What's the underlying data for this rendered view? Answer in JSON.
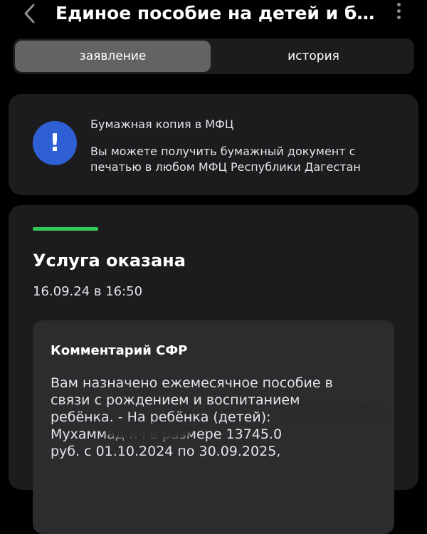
{
  "header": {
    "title": "Единое пособие на детей и бе...",
    "back_icon": "chevron-left-icon",
    "more_icon": "more-vertical-icon"
  },
  "segment": {
    "tabs": [
      "заявление",
      "история"
    ],
    "active": "заявление"
  },
  "info_card": {
    "icon": "exclamation-icon",
    "icon_symbol": "!",
    "icon_color": "#2f5fd4",
    "heading": "Бумажная копия в МФЦ",
    "text": "Вы можете получить бумажный документ с печатью в любом МФЦ Республики Дагестан"
  },
  "status_card": {
    "accent_color": "#34c759",
    "title": "Услуга оказана",
    "date": "16.09.24 в 16:50",
    "comment": {
      "title": "Комментарий СФР",
      "lines": [
        "Вам назначено ежемесячное пособие в",
        "связи с рождением и воспитанием",
        "ребёнка. - На ребёнка (детей):",
        "Мухаммад            ич в размере 13745.0",
        "руб. с 01.10.2024 по 30.09.2025,"
      ]
    }
  }
}
